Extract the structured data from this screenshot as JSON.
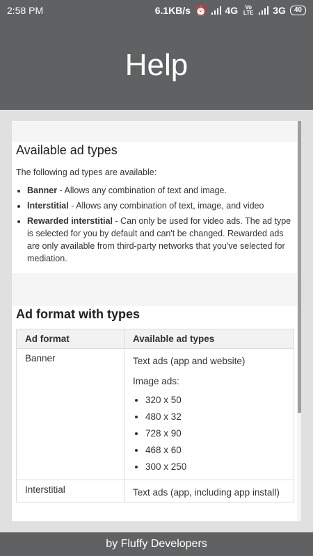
{
  "status_bar": {
    "time": "2:58 PM",
    "network_speed": "6.1KB/s",
    "sim1": "4G",
    "volte": "Vo LTE",
    "sim2": "3G",
    "battery": "40"
  },
  "header": {
    "title": "Help"
  },
  "section_types": {
    "heading": "Available ad types",
    "intro": "The following ad types are available:",
    "items": [
      {
        "name": "Banner",
        "desc": " - Allows any combination of text and image."
      },
      {
        "name": "Interstitial",
        "desc": " - Allows any combination of text, image, and video"
      },
      {
        "name": "Rewarded interstitial",
        "desc": " - Can only be used for video ads. The ad type is selected for you by default and can't be changed. Rewarded ads are only available from third-party networks that you've selected for mediation."
      }
    ]
  },
  "section_formats": {
    "heading": "Ad format with types",
    "table_headers": [
      "Ad format",
      "Available ad types"
    ],
    "rows": [
      {
        "format": "Banner",
        "types_line1": "Text ads (app and website)",
        "types_line2": "Image ads:",
        "sizes": [
          "320 x 50",
          "480 x 32",
          "728 x 90",
          "468 x 60",
          "300 x 250"
        ]
      },
      {
        "format": "Interstitial",
        "types_line1": "Text ads (app, including app install)"
      }
    ]
  },
  "footer": {
    "text": "by Fluffy Developers"
  }
}
